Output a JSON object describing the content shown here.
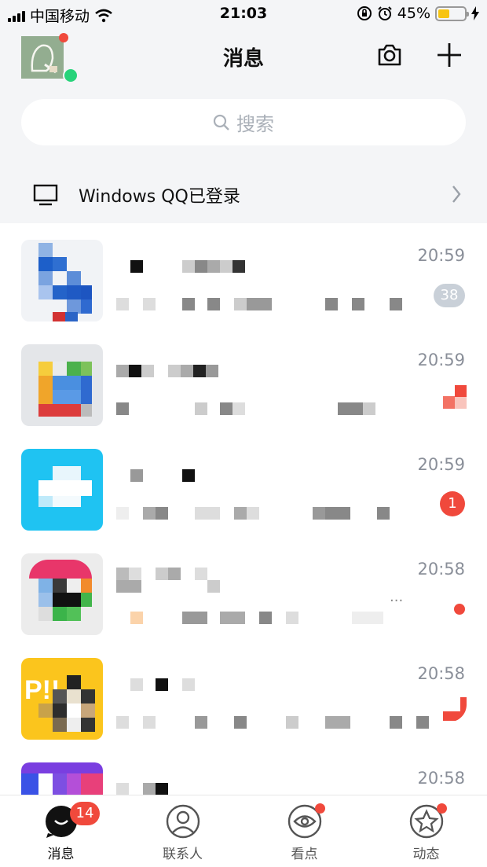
{
  "status_bar": {
    "carrier": "中国移动",
    "time": "21:03",
    "battery": "45%"
  },
  "header": {
    "title": "消息"
  },
  "search": {
    "placeholder": "搜索"
  },
  "login_notice": {
    "text": "Windows QQ已登录"
  },
  "conversations": [
    {
      "time": "20:59",
      "badge": "38",
      "badge_type": "muted"
    },
    {
      "time": "20:59",
      "badge": "",
      "badge_type": "partial"
    },
    {
      "time": "20:59",
      "badge": "1",
      "badge_type": "red"
    },
    {
      "time": "20:58",
      "badge": "",
      "badge_type": "dot"
    },
    {
      "time": "20:58",
      "badge": "",
      "badge_type": "partial"
    },
    {
      "time": "20:58",
      "badge": "",
      "badge_type": "none"
    }
  ],
  "tabbar": {
    "tabs": [
      {
        "label": "消息",
        "count": "14"
      },
      {
        "label": "联系人"
      },
      {
        "label": "看点"
      },
      {
        "label": "动态"
      }
    ]
  },
  "colors": {
    "accent_red": "#f0493c",
    "online_green": "#27d37a",
    "background_gray": "#f4f5f7"
  }
}
